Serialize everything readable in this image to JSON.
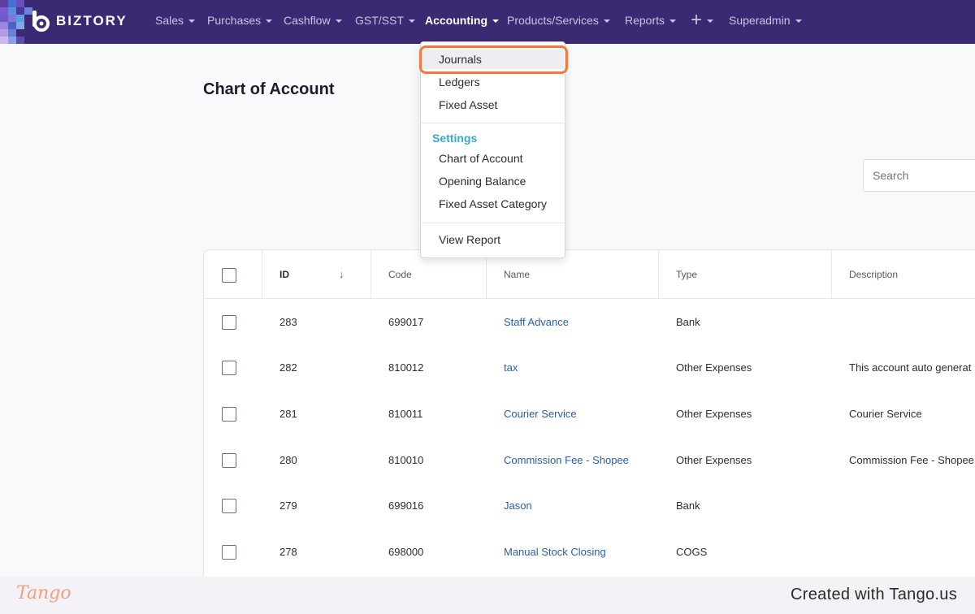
{
  "brand": {
    "name": "BIZTORY"
  },
  "nav": {
    "items": [
      {
        "label": "Sales"
      },
      {
        "label": "Purchases"
      },
      {
        "label": "Cashflow"
      },
      {
        "label": "GST/SST"
      },
      {
        "label": "Accounting",
        "active": true
      },
      {
        "label": "Products/Services"
      },
      {
        "label": "Reports"
      },
      {
        "label": "+"
      },
      {
        "label": "Superadmin"
      }
    ]
  },
  "page": {
    "title": "Chart of Account"
  },
  "search": {
    "placeholder": "Search"
  },
  "table": {
    "headers": {
      "id": "ID",
      "code": "Code",
      "name": "Name",
      "type": "Type",
      "description": "Description"
    },
    "rows": [
      {
        "id": "283",
        "code": "699017",
        "name": "Staff Advance",
        "type": "Bank",
        "description": ""
      },
      {
        "id": "282",
        "code": "810012",
        "name": "tax",
        "type": "Other Expenses",
        "description": "This account auto generat"
      },
      {
        "id": "281",
        "code": "810011",
        "name": "Courier Service",
        "type": "Other Expenses",
        "description": "Courier Service"
      },
      {
        "id": "280",
        "code": "810010",
        "name": "Commission Fee - Shopee",
        "type": "Other Expenses",
        "description": "Commission Fee - Shopee"
      },
      {
        "id": "279",
        "code": "699016",
        "name": "Jason",
        "type": "Bank",
        "description": ""
      },
      {
        "id": "278",
        "code": "698000",
        "name": "Manual Stock Closing",
        "type": "COGS",
        "description": ""
      }
    ]
  },
  "dropdown": {
    "items": [
      "Journals",
      "Ledgers",
      "Fixed Asset"
    ],
    "settings_header": "Settings",
    "settings_items": [
      "Chart of Account",
      "Opening Balance",
      "Fixed Asset Category"
    ],
    "report_item": "View Report"
  },
  "footer": {
    "tango": "Tango",
    "created": "Created with Tango.us"
  },
  "colors": {
    "nav_bg": "#3b2a73",
    "highlight": "#f07a3e",
    "settings_header": "#35a8d8",
    "link": "#2a5ea8"
  }
}
